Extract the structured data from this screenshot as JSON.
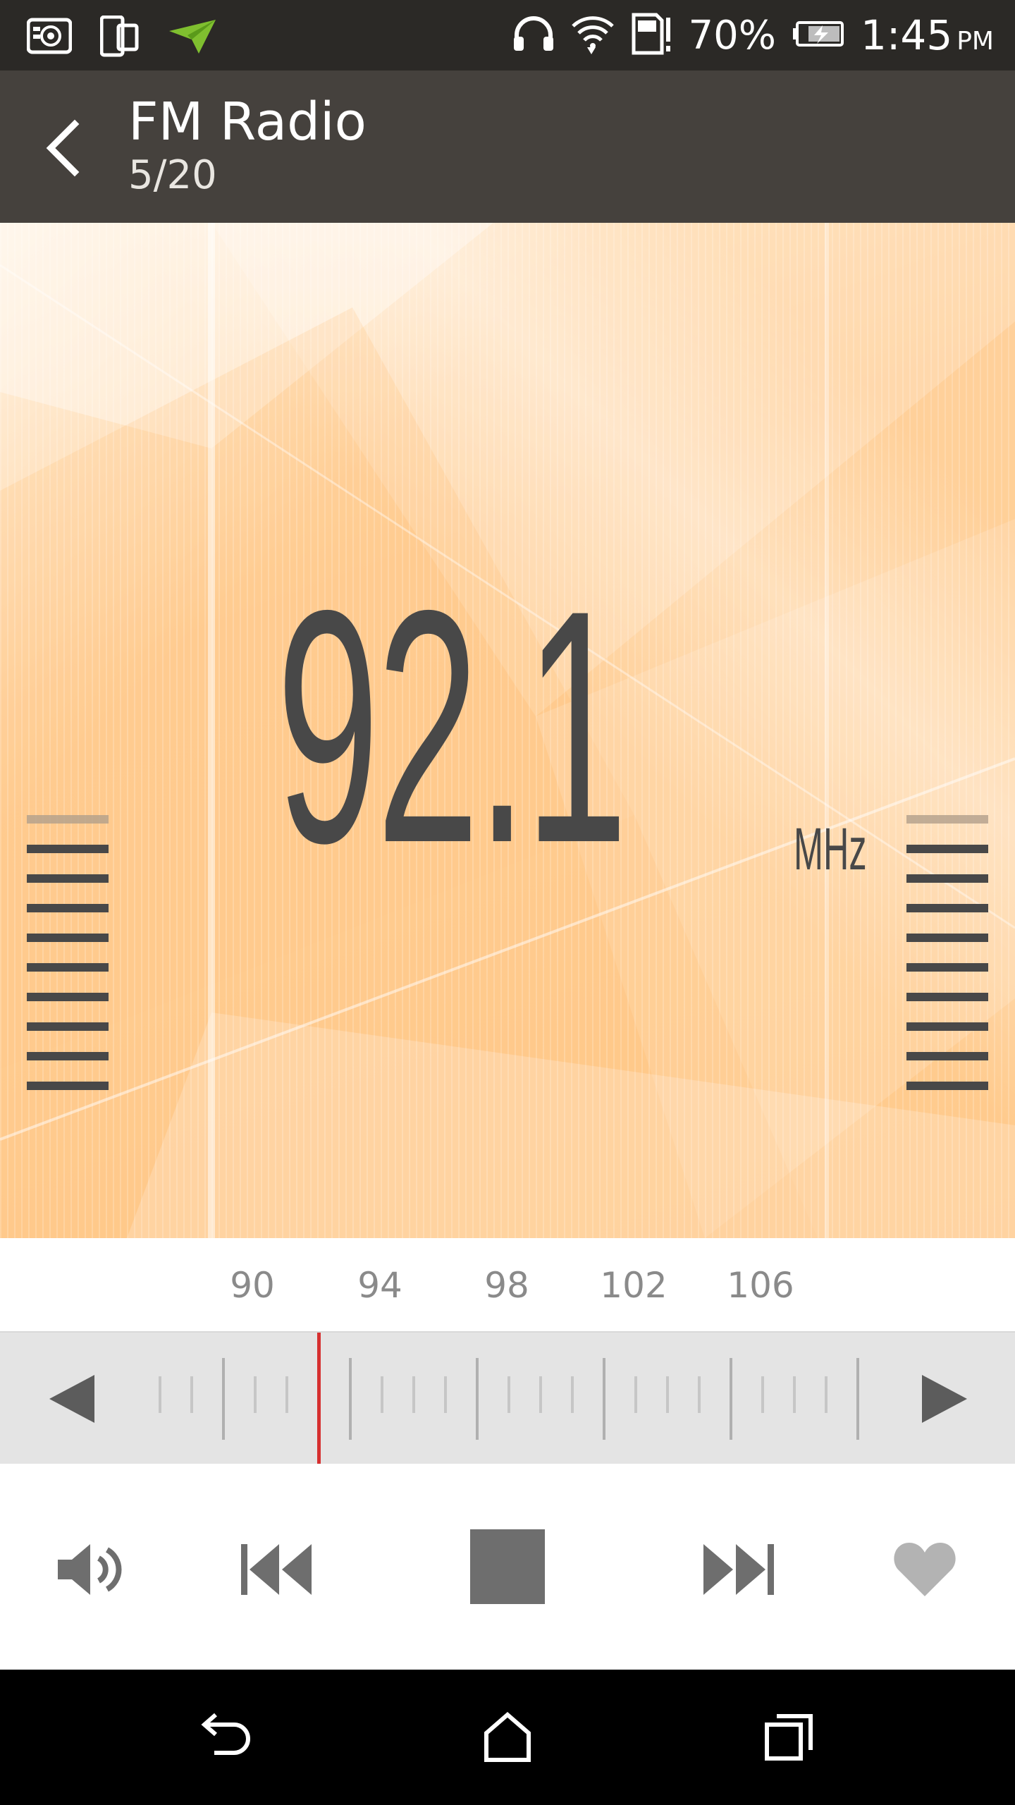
{
  "status_bar": {
    "left_icons": [
      "bbm-icon",
      "device-icon",
      "airdroid-icon"
    ],
    "right_icons": [
      "headphones-icon",
      "wifi-icon",
      "sd-card-icon"
    ],
    "battery_percent": "70%",
    "time": "1:45",
    "time_suffix": "PM"
  },
  "app_bar": {
    "back_icon": "back-arrow-icon",
    "title": "FM Radio",
    "subtitle": "5/20"
  },
  "display": {
    "frequency": "92.1",
    "unit": "MHz",
    "left_level_bars": 10,
    "right_level_bars": 10
  },
  "scale": {
    "labels": [
      "90",
      "94",
      "98",
      "102",
      "106"
    ],
    "needle_color": "#d63030"
  },
  "controls": {
    "volume_icon": "volume-icon",
    "prev_icon": "skip-previous-icon",
    "stop_icon": "stop-icon",
    "next_icon": "skip-next-icon",
    "favorite_icon": "heart-icon"
  },
  "nav_bar": {
    "icons": [
      "back-icon",
      "home-icon",
      "recents-icon"
    ]
  },
  "colors": {
    "status_bar": "#2b2926",
    "app_bar": "#45413d",
    "hero_base": "#ffcf96",
    "digits": "#484848",
    "accent_red": "#d63030"
  }
}
